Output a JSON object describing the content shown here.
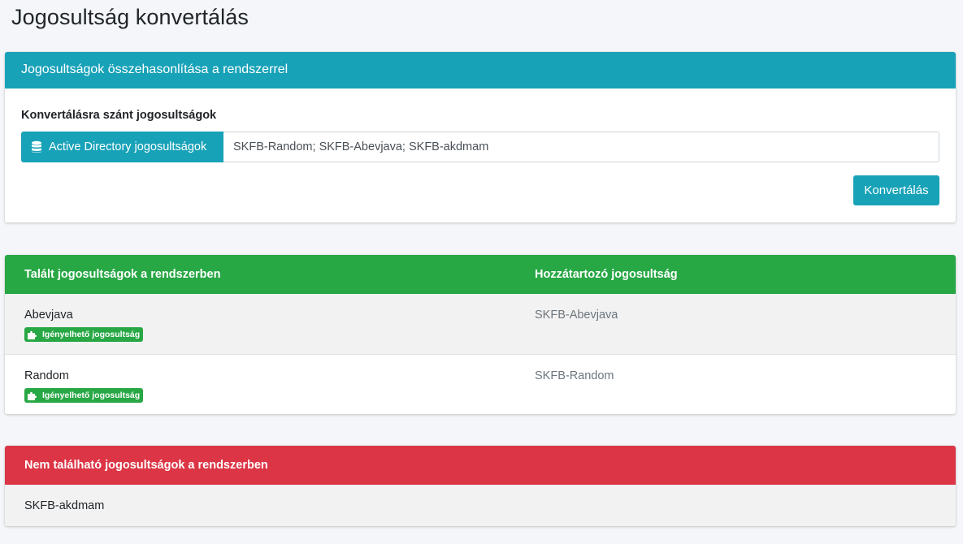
{
  "page": {
    "title": "Jogosultság konvertálás"
  },
  "compare_card": {
    "header": "Jogosultságok összehasonlítása a rendszerrel",
    "field_label": "Konvertálásra szánt jogosultságok",
    "prepend_label": "Active Directory jogosultságok",
    "prepend_icon": "database-icon",
    "input_value": "SKFB-Random; SKFB-Abevjava; SKFB-akdmam",
    "convert_button": "Konvertálás"
  },
  "found_table": {
    "headers": [
      "Talált jogosultságok a rendszerben",
      "Hozzátartozó jogosultság"
    ],
    "rows": [
      {
        "name": "Abevjava",
        "badge": "Igényelhető jogosultság",
        "badge_icon": "puzzle-icon",
        "mapped": "SKFB-Abevjava"
      },
      {
        "name": "Random",
        "badge": "Igényelhető jogosultság",
        "badge_icon": "puzzle-icon",
        "mapped": "SKFB-Random"
      }
    ]
  },
  "missing_table": {
    "header": "Nem található jogosultságok a rendszerben",
    "rows": [
      "SKFB-akdmam"
    ]
  },
  "colors": {
    "info": "#17a2b8",
    "success": "#28a745",
    "danger": "#dc3545",
    "background": "#f4f6f9"
  }
}
